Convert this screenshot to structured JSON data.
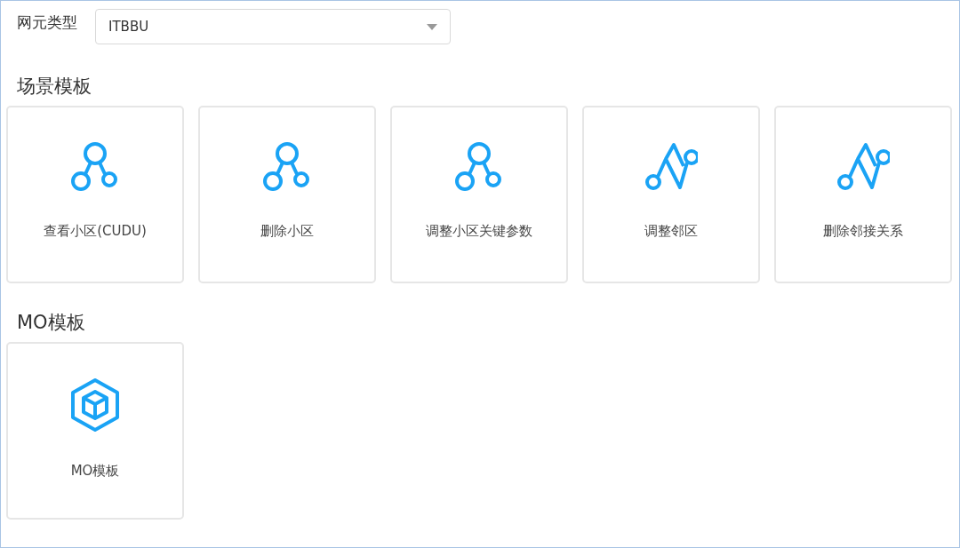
{
  "ne_type": {
    "label": "网元类型",
    "value": "ITBBU"
  },
  "sections": [
    {
      "title": "场景模板",
      "cards": [
        {
          "label": "查看小区(CUDU)",
          "kind": "nodes"
        },
        {
          "label": "删除小区",
          "kind": "nodes"
        },
        {
          "label": "调整小区关键参数",
          "kind": "nodes"
        },
        {
          "label": "调整邻区",
          "kind": "zigzag"
        },
        {
          "label": "删除邻接关系",
          "kind": "zigzag"
        }
      ]
    },
    {
      "title": "MO模板",
      "cards": [
        {
          "label": "MO模板",
          "kind": "cube"
        }
      ]
    }
  ]
}
